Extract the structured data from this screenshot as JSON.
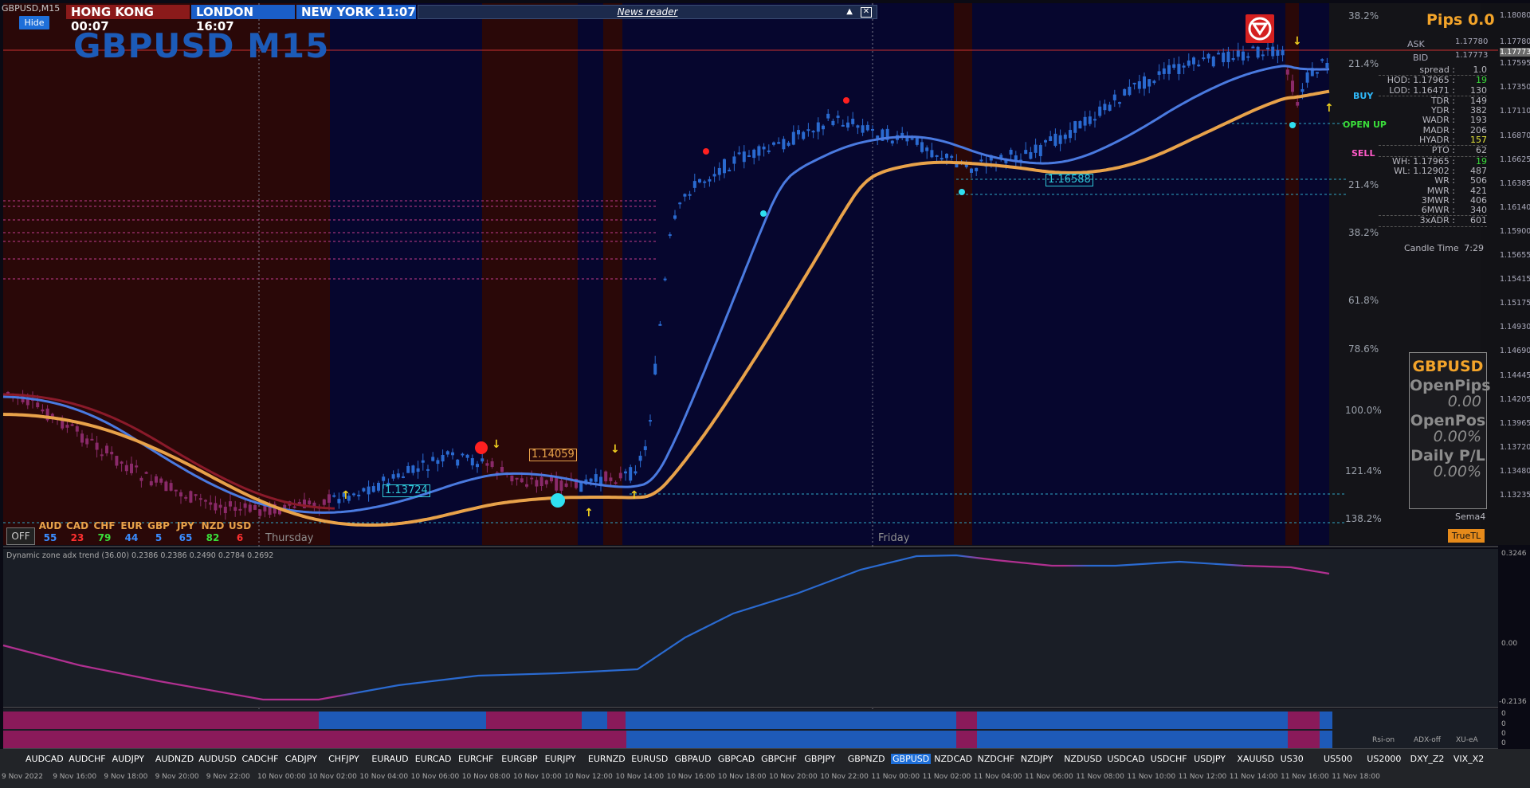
{
  "window": {
    "title": "GBPUSD,M15"
  },
  "header": {
    "hide_label": "Hide",
    "clocks": [
      {
        "label": "HONG KONG 00:07"
      },
      {
        "label": "LONDON   16:07"
      },
      {
        "label": "NEW YORK  11:07"
      }
    ],
    "news_label": "News reader",
    "symbol_title": "GBPUSD M15"
  },
  "chart": {
    "fib_levels": [
      "38.2%",
      "21.4%",
      "21.4%",
      "38.2%",
      "61.8%",
      "78.6%",
      "100.0%",
      "121.4%",
      "138.2%"
    ],
    "price_axis": [
      "1.18080",
      "1.17780",
      "1.17773",
      "1.17595",
      "1.17350",
      "1.17110",
      "1.16870",
      "1.16625",
      "1.16385",
      "1.16140",
      "1.15900",
      "1.15655",
      "1.15415",
      "1.15175",
      "1.14930",
      "1.14690",
      "1.14445",
      "1.14205",
      "1.13965",
      "1.13720",
      "1.13480",
      "1.13235"
    ],
    "price_labels": {
      "a": "1.13724",
      "b": "1.14059",
      "c": "1.16588"
    },
    "days": [
      "Thursday",
      "Friday"
    ]
  },
  "panel": {
    "pips": "Pips 0.0",
    "ask_label": "ASK",
    "ask_value": "1.17780",
    "bid_label": "BID",
    "bid_value": "1.17773",
    "stats": [
      {
        "k": "spread :",
        "v": "1.0"
      },
      {
        "k": "HOD: 1.17965 :",
        "v": "19"
      },
      {
        "k": "LOD: 1.16471 :",
        "v": "130"
      },
      {
        "k": "TDR :",
        "v": "149"
      },
      {
        "k": "YDR :",
        "v": "382"
      },
      {
        "k": "WADR :",
        "v": "193"
      },
      {
        "k": "MADR :",
        "v": "206"
      },
      {
        "k": "HYADR :",
        "v": "157"
      },
      {
        "k": "PTO :",
        "v": "62"
      },
      {
        "k": "WH: 1.17965 :",
        "v": "19"
      },
      {
        "k": "WL: 1.12902 :",
        "v": "487"
      },
      {
        "k": "WR :",
        "v": "506"
      },
      {
        "k": "MWR :",
        "v": "421"
      },
      {
        "k": "3MWR :",
        "v": "406"
      },
      {
        "k": "6MWR :",
        "v": "340"
      },
      {
        "k": "3xADR :",
        "v": "601"
      }
    ],
    "signals": {
      "buy": "BUY",
      "open_up": "OPEN UP",
      "sell": "SELL"
    },
    "candle_time_label": "Candle Time",
    "candle_time_value": "7:29",
    "box_symbol": "GBPUSD",
    "open_pips_label": "OpenPips",
    "open_pips_value": "0.00",
    "open_pos_label": "OpenPos",
    "open_pos_value": "0.00%",
    "daily_pl_label": "Daily P/L",
    "daily_pl_value": "0.00%",
    "sema_label": "Sema4",
    "truetl_label": "TrueTL"
  },
  "currencies": [
    {
      "name": "AUD",
      "value": "55",
      "color": "#3a8cff"
    },
    {
      "name": "CAD",
      "value": "23",
      "color": "#ff3030"
    },
    {
      "name": "CHF",
      "value": "79",
      "color": "#3adf3a"
    },
    {
      "name": "EUR",
      "value": "44",
      "color": "#3a8cff"
    },
    {
      "name": "GBP",
      "value": "5",
      "color": "#3a8cff"
    },
    {
      "name": "JPY",
      "value": "65",
      "color": "#3a8cff"
    },
    {
      "name": "NZD",
      "value": "82",
      "color": "#3adf3a"
    },
    {
      "name": "USD",
      "value": "6",
      "color": "#ff3030"
    }
  ],
  "off_label": "OFF",
  "indicator": {
    "label": "Dynamic zone adx trend (36.00) 0.2386 0.2386 0.2490 0.2784 0.2692",
    "scale": [
      "0.3246",
      "0.00",
      "-0.2136"
    ],
    "bars_scale": [
      "0",
      "0",
      "0",
      "0"
    ],
    "mini": [
      "Rsi-on",
      "ADX-off",
      "XU-eA"
    ]
  },
  "symbols": [
    "AUDCAD",
    "AUDCHF",
    "AUDJPY",
    "AUDNZD",
    "AUDUSD",
    "CADCHF",
    "CADJPY",
    "CHFJPY",
    "EURAUD",
    "EURCAD",
    "EURCHF",
    "EURGBP",
    "EURJPY",
    "EURNZD",
    "EURUSD",
    "GBPAUD",
    "GBPCAD",
    "GBPCHF",
    "GBPJPY",
    "GBPNZD",
    "GBPUSD",
    "NZDCAD",
    "NZDCHF",
    "NZDJPY",
    "NZDUSD",
    "USDCAD",
    "USDCHF",
    "USDJPY",
    "XAUUSD",
    "US30",
    "US500",
    "US2000",
    "DXY_Z2",
    "VIX_X2"
  ],
  "active_symbol": "GBPUSD",
  "time_axis": [
    "9 Nov 2022",
    "9 Nov 16:00",
    "9 Nov 18:00",
    "9 Nov 20:00",
    "9 Nov 22:00",
    "10 Nov 00:00",
    "10 Nov 02:00",
    "10 Nov 04:00",
    "10 Nov 06:00",
    "10 Nov 08:00",
    "10 Nov 10:00",
    "10 Nov 12:00",
    "10 Nov 14:00",
    "10 Nov 16:00",
    "10 Nov 18:00",
    "10 Nov 20:00",
    "10 Nov 22:00",
    "11 Nov 00:00",
    "11 Nov 02:00",
    "11 Nov 04:00",
    "11 Nov 06:00",
    "11 Nov 08:00",
    "11 Nov 10:00",
    "11 Nov 12:00",
    "11 Nov 14:00",
    "11 Nov 16:00",
    "11 Nov 18:00"
  ]
}
